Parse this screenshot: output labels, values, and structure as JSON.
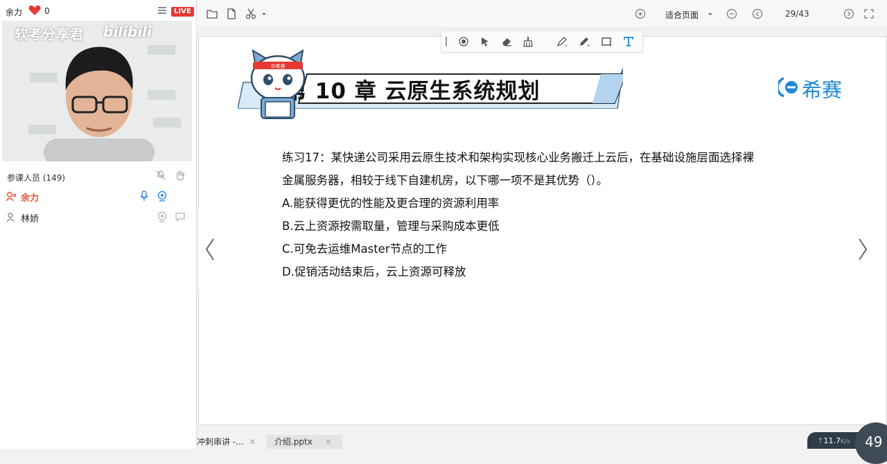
{
  "live_panel": {
    "host_name": "余力",
    "like_count": "0",
    "live_badge": "LIVE",
    "watermark_text": "软考分享君",
    "watermark_logo": "bilibili",
    "participants_title": "参课人员 (149)",
    "users": [
      {
        "name": "余力",
        "role": "host",
        "color": "#e8502a"
      },
      {
        "name": "林娇",
        "role": "member",
        "color": "#222222"
      }
    ]
  },
  "viewer": {
    "fit_label": "适合页面",
    "page_counter": "29/43",
    "icons": {
      "toolbar": [
        "folder-icon",
        "file-icon",
        "scissors-icon",
        "chevron-down-icon",
        "zoom-in-icon",
        "zoom-out-icon",
        "prev-page-icon",
        "next-page-icon",
        "fullscreen-icon"
      ],
      "annotation": [
        "record-icon",
        "pointer-icon",
        "eraser-icon",
        "broom-icon",
        "highlighter-icon",
        "pen-icon",
        "rectangle-icon",
        "text-icon"
      ]
    },
    "slide": {
      "chapter_title": "第 10 章 云原生系统规划",
      "brand": "希赛",
      "brand_color": "#1e88d6",
      "mascot_band": "中希赛",
      "question_lines": [
        "练习17：某快递公司采用云原生技术和架构实现核心业务搬迁上云后，在基础设施层面选择裸",
        "金属服务器，相较于线下自建机房，以下哪一项不是其优势（）。",
        "A.能获得更优的性能及更合理的资源利用率",
        "B.云上资源按需取量，管理与采购成本更低",
        "C.可免去运维Master节点的工作",
        "D.促销活动结束后，云上资源可释放"
      ]
    },
    "tabs": [
      {
        "label": "冲刺串讲 -..."
      },
      {
        "label": "介绍.pptx"
      }
    ],
    "net_speed": "11.7",
    "net_unit": "K/s",
    "counter_circle": "49"
  }
}
